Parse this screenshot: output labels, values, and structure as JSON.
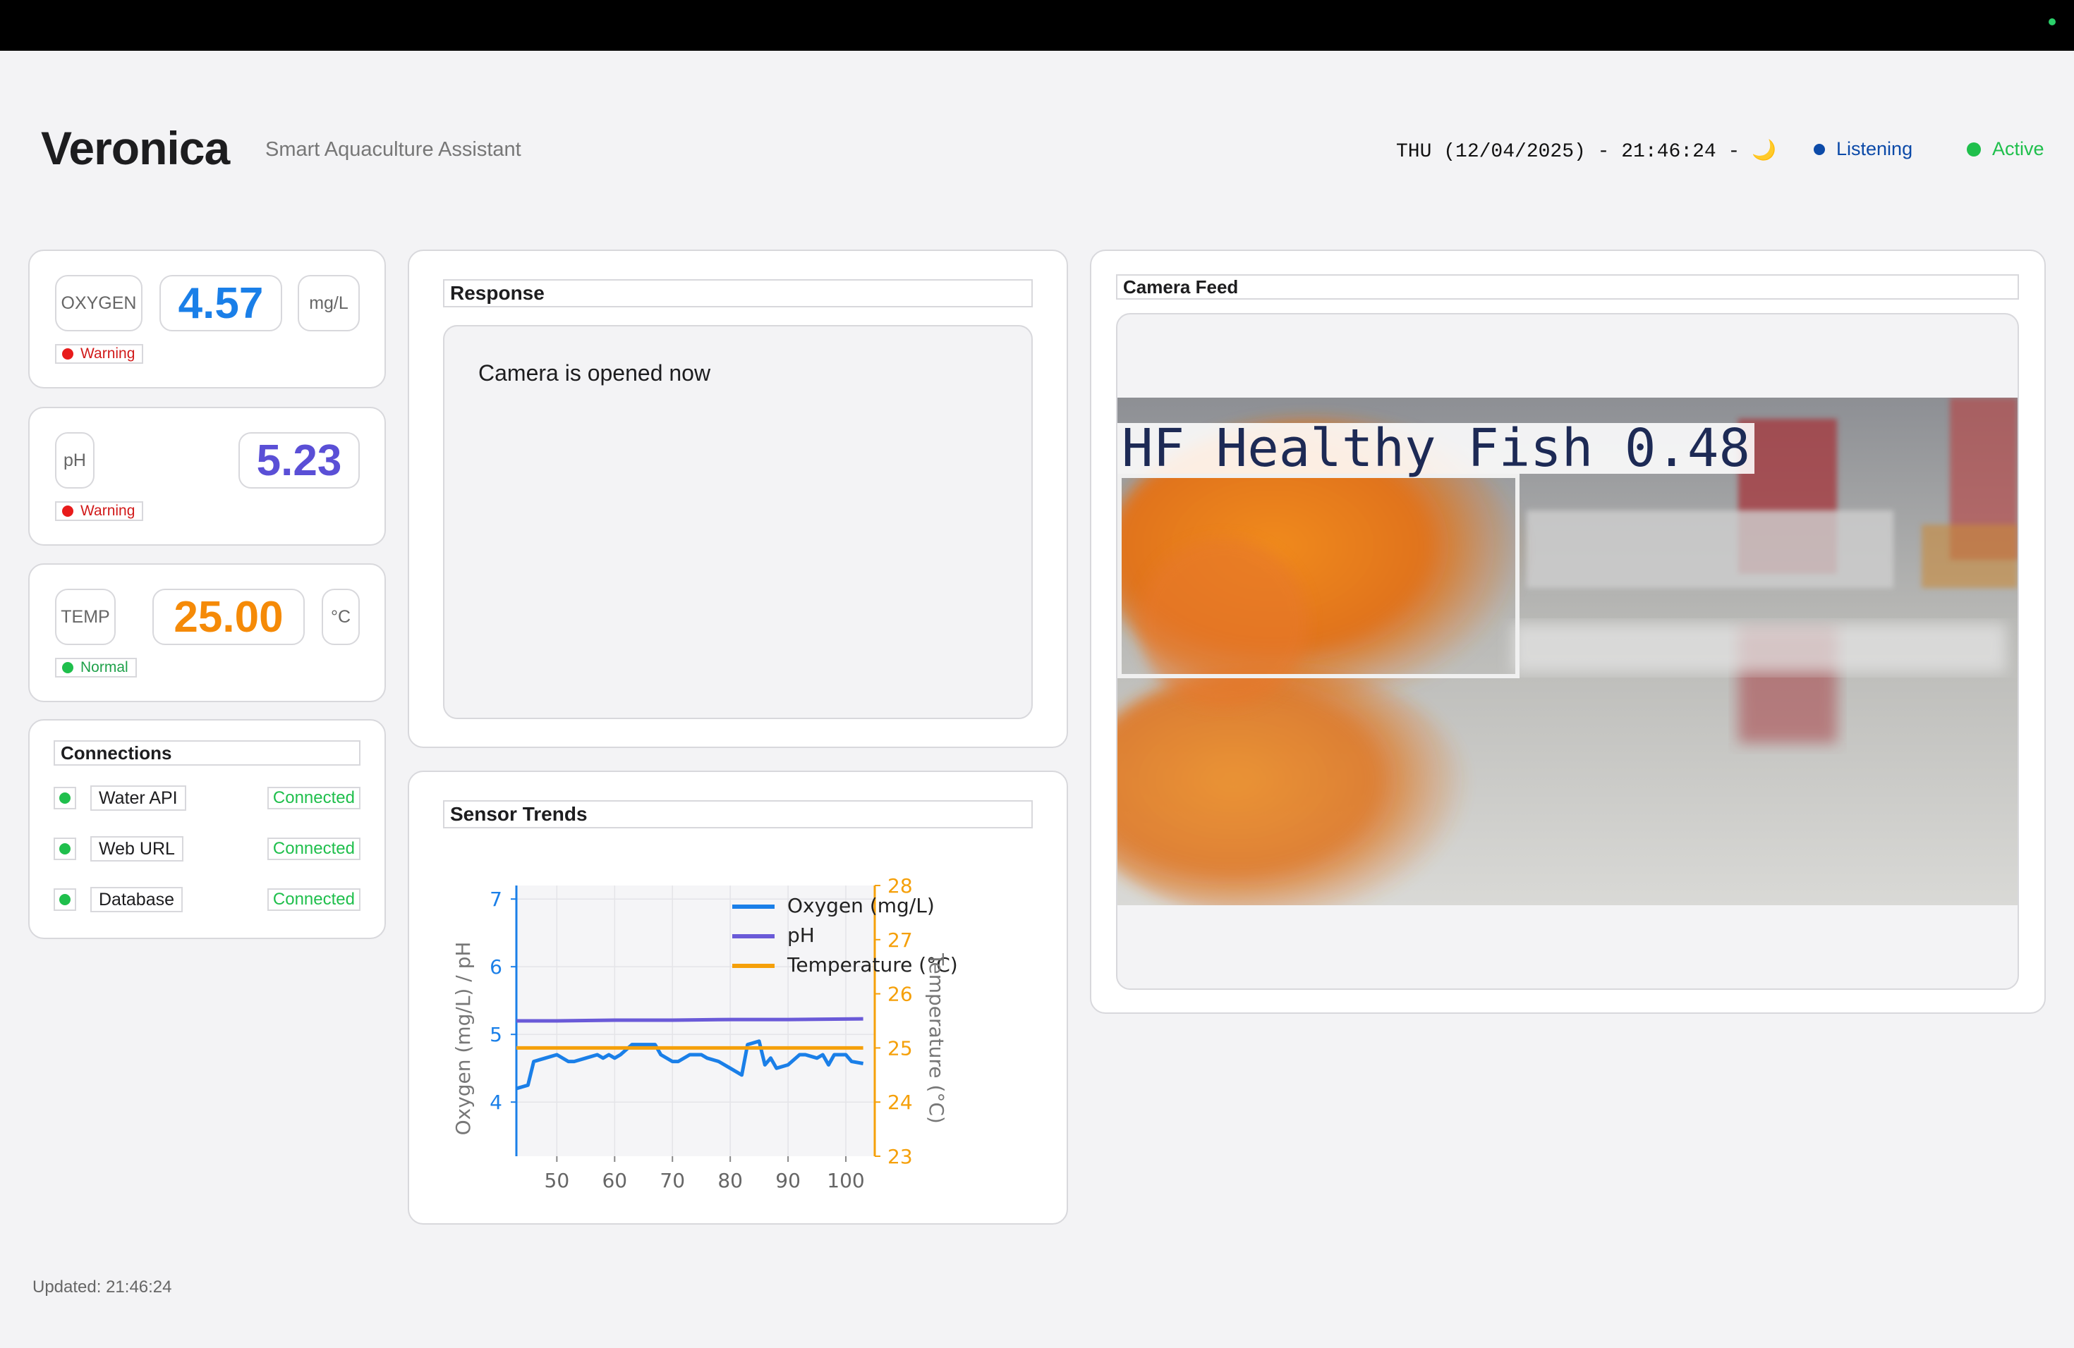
{
  "header": {
    "app_name": "Veronica",
    "tagline": "Smart Aquaculture Assistant",
    "clock": "THU (12/04/2025) - 21:46:24 - 🌙",
    "status_listening": "Listening",
    "status_active": "Active"
  },
  "sensors": {
    "oxygen": {
      "label": "OXYGEN",
      "value": "4.57",
      "unit": "mg/L",
      "status": "Warning",
      "color": "#1a7fe8"
    },
    "ph": {
      "label": "pH",
      "value": "5.23",
      "status": "Warning",
      "color": "#5a4fd6"
    },
    "temp": {
      "label": "TEMP",
      "value": "25.00",
      "unit": "°C",
      "status": "Normal",
      "color": "#f58a07"
    }
  },
  "connections": {
    "title": "Connections",
    "items": [
      {
        "name": "Water API",
        "status": "Connected"
      },
      {
        "name": "Web URL",
        "status": "Connected"
      },
      {
        "name": "Database",
        "status": "Connected"
      }
    ]
  },
  "response": {
    "title": "Response",
    "text": "Camera is opened now"
  },
  "trends": {
    "title": "Sensor Trends"
  },
  "camera": {
    "title": "Camera Feed",
    "detection_label": "HF Healthy Fish 0.48"
  },
  "footer": {
    "updated": "Updated: 21:46:24"
  },
  "chart_data": {
    "type": "line",
    "xlabel": "",
    "ylabel": "Oxygen (mg/L) / pH",
    "y2label": "Temperature (°C)",
    "xlim": [
      43,
      105
    ],
    "ylim": [
      3.2,
      7.2
    ],
    "y2lim": [
      23,
      28
    ],
    "xticks": [
      50,
      60,
      70,
      80,
      90,
      100
    ],
    "yticks": [
      4,
      5,
      6,
      7
    ],
    "y2ticks": [
      23,
      24,
      25,
      26,
      27,
      28
    ],
    "grid": true,
    "legend_position": "top-right",
    "series": [
      {
        "name": "Oxygen (mg/L)",
        "axis": "left",
        "color": "#1a7fe8",
        "x": [
          43,
          45,
          46,
          48,
          50,
          52,
          53,
          55,
          57,
          58,
          59,
          60,
          61,
          63,
          65,
          67,
          68,
          70,
          71,
          73,
          75,
          76,
          78,
          80,
          82,
          83,
          85,
          86,
          87,
          88,
          90,
          92,
          93,
          95,
          96,
          97,
          98,
          100,
          101,
          103
        ],
        "y": [
          4.2,
          4.25,
          4.6,
          4.65,
          4.7,
          4.6,
          4.6,
          4.65,
          4.7,
          4.65,
          4.7,
          4.65,
          4.7,
          4.85,
          4.85,
          4.85,
          4.7,
          4.6,
          4.6,
          4.7,
          4.7,
          4.65,
          4.6,
          4.5,
          4.4,
          4.85,
          4.9,
          4.55,
          4.65,
          4.5,
          4.55,
          4.7,
          4.7,
          4.65,
          4.7,
          4.55,
          4.7,
          4.7,
          4.6,
          4.57
        ]
      },
      {
        "name": "pH",
        "axis": "left",
        "color": "#6a5ad8",
        "x": [
          43,
          50,
          60,
          70,
          80,
          90,
          103
        ],
        "y": [
          5.2,
          5.2,
          5.21,
          5.21,
          5.22,
          5.22,
          5.23
        ]
      },
      {
        "name": "Temperature (°C)",
        "axis": "right",
        "color": "#f5a00a",
        "x": [
          43,
          50,
          60,
          70,
          80,
          90,
          103
        ],
        "y": [
          25,
          25,
          25,
          25,
          25,
          25,
          25
        ]
      }
    ]
  }
}
